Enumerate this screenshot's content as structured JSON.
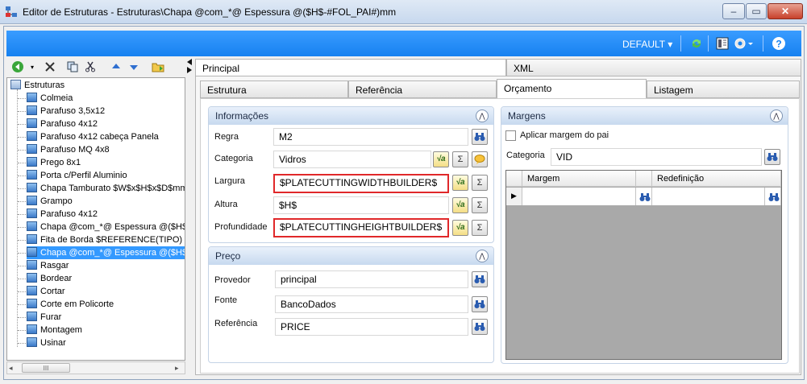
{
  "window": {
    "title": "Editor de Estruturas - Estruturas\\Chapa @com_*@ Espessura @($H$-#FOL_PAI#)mm",
    "minimize": "–",
    "maximize": "▭",
    "close": "✕"
  },
  "topbar": {
    "profile": "DEFAULT",
    "profile_arrow": "▾"
  },
  "tree": {
    "root": "Estruturas",
    "items": [
      "Colmeia",
      "Parafuso 3,5x12",
      "Parafuso 4x12",
      "Parafuso 4x12  cabeça Panela",
      "Parafuso MQ 4x8",
      "Prego 8x1",
      "Porta c/Perfil Aluminio",
      "Chapa Tamburato $W$x$H$x$D$mm",
      "Grampo",
      "Parafuso 4x12",
      "Chapa  @com_*@ Espessura  @($H$-#FOL_PAI#)mm",
      "Fita de Borda $REFERENCE(TIPO)",
      "Chapa  @com_*@ Espessura  @($H$-#FOL_PAI#)mm",
      "Rasgar",
      "Bordear",
      "Cortar",
      "Corte em Policorte",
      "Furar",
      "Montagem",
      "Usinar"
    ],
    "selected_index": 12,
    "scroll_label": "III"
  },
  "tabs_top": [
    "Principal",
    "XML"
  ],
  "tabs_second": [
    "Estrutura",
    "Referência",
    "Orçamento",
    "Listagem"
  ],
  "info": {
    "header": "Informações",
    "regra_label": "Regra",
    "regra_value": "M2",
    "categoria_label": "Categoria",
    "categoria_value": "Vidros",
    "largura_label": "Largura",
    "largura_value": "$PLATECUTTINGWIDTHBUILDER$",
    "altura_label": "Altura",
    "altura_value": "$H$",
    "profundidade_label": "Profundidade",
    "profundidade_value": "$PLATECUTTINGHEIGHTBUILDER$"
  },
  "preco": {
    "header": "Preço",
    "provedor_label": "Provedor",
    "provedor_value": "principal",
    "fonte_label": "Fonte",
    "fonte_value": "BancoDados",
    "referencia_label": "Referência",
    "referencia_value": "PRICE"
  },
  "margens": {
    "header": "Margens",
    "checkbox_label": "Aplicar margem do pai",
    "checkbox_checked": false,
    "categoria_label": "Categoria",
    "categoria_value": "VID",
    "grid_columns": [
      "Margem",
      "Redefinição"
    ]
  },
  "icons": {
    "binoculars": "🔭",
    "fx": "√a",
    "sigma": "Σ",
    "collapse": "⌃"
  },
  "colors": {
    "accent": "#1e90ff",
    "highlight": "#e0282a",
    "selection": "#3399ff"
  }
}
